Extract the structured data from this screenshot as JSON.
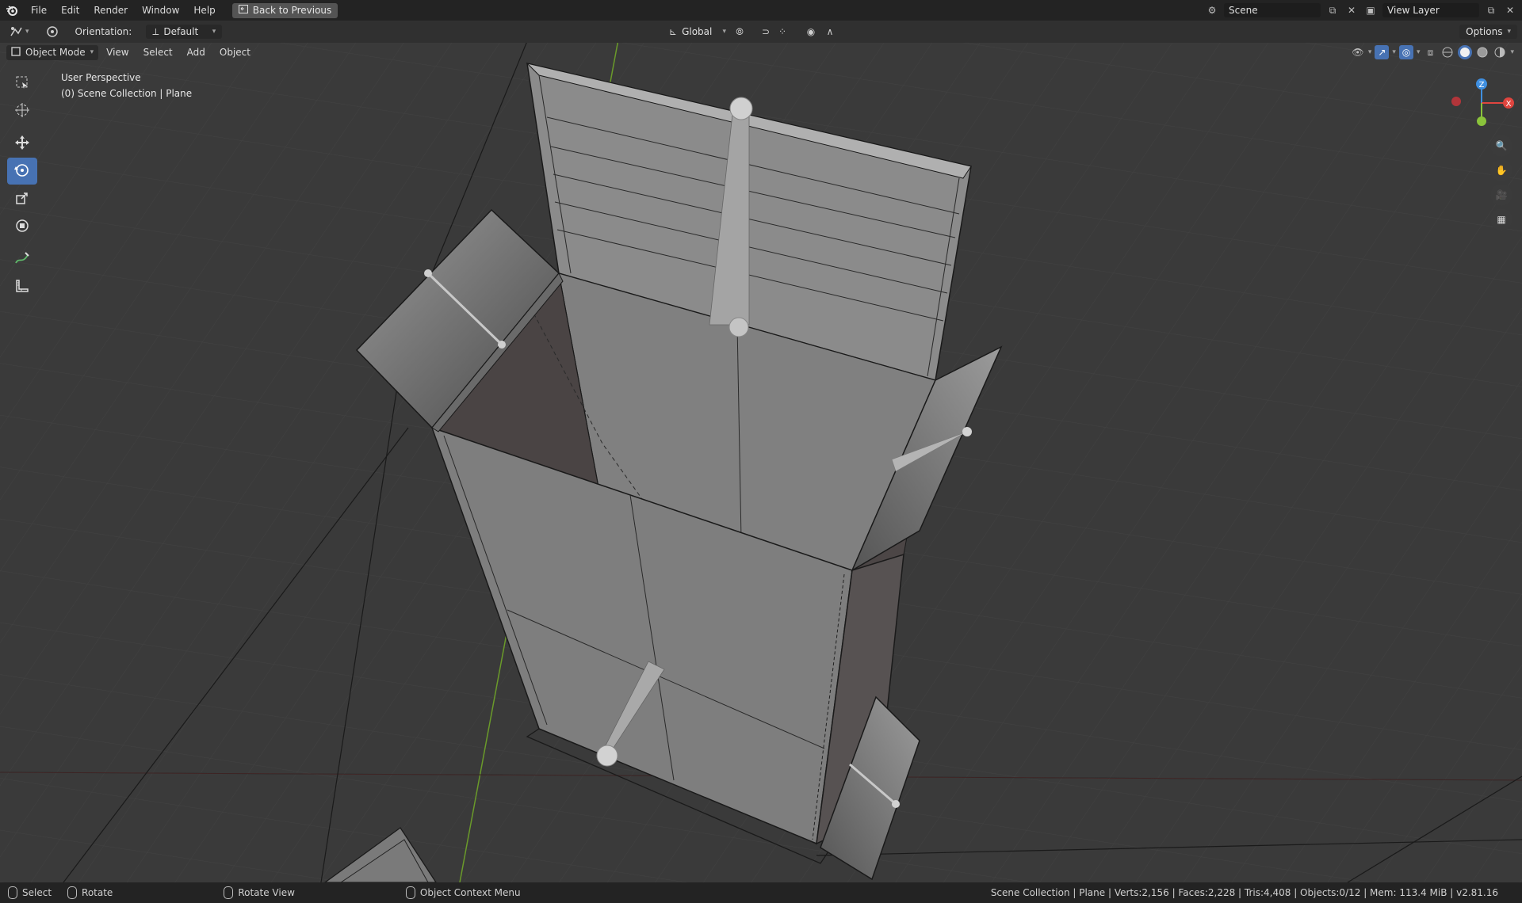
{
  "menu": {
    "items": [
      "File",
      "Edit",
      "Render",
      "Window",
      "Help"
    ],
    "back_button": "Back to Previous"
  },
  "top_right": {
    "scene_label": "Scene",
    "view_layer_label": "View Layer"
  },
  "tool_header": {
    "orientation_label": "Orientation:",
    "orientation_value": "Default",
    "transform_orientation": "Global",
    "options_label": "Options"
  },
  "viewport_header": {
    "mode": "Object Mode",
    "menus": [
      "View",
      "Select",
      "Add",
      "Object"
    ]
  },
  "overlay": {
    "view_name": "User Perspective",
    "collection": "(0) Scene Collection | Plane"
  },
  "toolbar": {
    "tools": [
      {
        "name": "select-box-icon",
        "active": false
      },
      {
        "name": "cursor-icon",
        "active": false
      },
      {
        "name": "move-icon",
        "active": false
      },
      {
        "name": "rotate-icon",
        "active": true
      },
      {
        "name": "scale-icon",
        "active": false
      },
      {
        "name": "transform-icon",
        "active": false
      },
      {
        "name": "annotate-icon",
        "active": false
      },
      {
        "name": "measure-icon",
        "active": false
      }
    ]
  },
  "gizmo": {
    "z_label": "Z",
    "x_label": "X",
    "colors": {
      "x": "#e0453f",
      "y": "#8ac33b",
      "z": "#3f8fe0"
    }
  },
  "statusbar": {
    "select": "Select",
    "rotate": "Rotate",
    "rotate_view": "Rotate View",
    "context_menu": "Object Context Menu",
    "stats": "Scene Collection | Plane | Verts:2,156 | Faces:2,228 | Tris:4,408 | Objects:0/12 | Mem: 113.4 MiB | v2.81.16"
  },
  "colors": {
    "accent": "#4772b3",
    "viewport_bg": "#3a3a3a",
    "header_bg": "#303030",
    "topbar_bg": "#232323"
  }
}
